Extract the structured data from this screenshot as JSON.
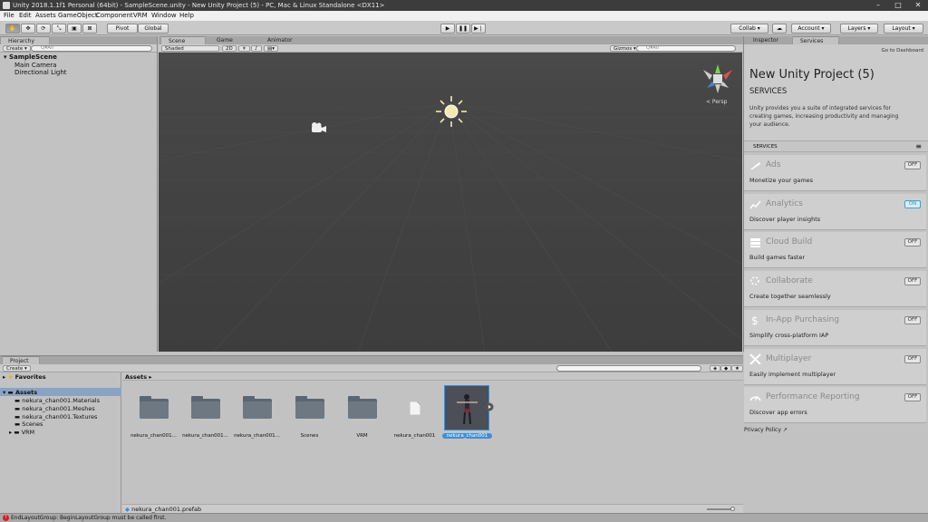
{
  "window": {
    "title": "Unity 2018.1.1f1 Personal (64bit) - SampleScene.unity - New Unity Project (5) - PC, Mac & Linux Standalone <DX11>",
    "minimize": "–",
    "maximize": "□",
    "close": "✕"
  },
  "menu": [
    "File",
    "Edit",
    "Assets",
    "GameObject",
    "Component",
    "VRM",
    "Window",
    "Help"
  ],
  "toolbar": {
    "pivot": "Pivot",
    "global": "Global",
    "collab": "Collab ▾",
    "account": "Account ▾",
    "layers": "Layers ▾",
    "layout": "Layout ▾"
  },
  "hierarchy": {
    "tab": "Hierarchy",
    "create": "Create ▾",
    "search": "Q▾All",
    "scene": "SampleScene",
    "items": [
      "Main Camera",
      "Directional Light"
    ]
  },
  "scene": {
    "tabs": [
      "Scene",
      "Game",
      "Animator"
    ],
    "shading": "Shaded",
    "mode2d": "2D",
    "gizmos": "Gizmos ▾",
    "search": "Q▾All",
    "persp": "< Persp"
  },
  "inspector": {
    "tabs": [
      "Inspector",
      "Services"
    ],
    "dashboard": "Go to Dashboard",
    "project_name": "New Unity Project (5)",
    "heading": "SERVICES",
    "description": "Unity provides you a suite of integrated services for creating games, increasing productivity and managing your audience.",
    "section_label": "SERVICES",
    "privacy": "Privacy Policy"
  },
  "services": [
    {
      "name": "Ads",
      "desc": "Monetize your games",
      "state": "OFF"
    },
    {
      "name": "Analytics",
      "desc": "Discover player insights",
      "state": "ON"
    },
    {
      "name": "Cloud Build",
      "desc": "Build games faster",
      "state": "OFF"
    },
    {
      "name": "Collaborate",
      "desc": "Create together seamlessly",
      "state": "OFF"
    },
    {
      "name": "In-App Purchasing",
      "desc": "Simplify cross-platform IAP",
      "state": "OFF"
    },
    {
      "name": "Multiplayer",
      "desc": "Easily implement multiplayer",
      "state": "OFF"
    },
    {
      "name": "Performance Reporting",
      "desc": "Discover app errors",
      "state": "OFF"
    }
  ],
  "project": {
    "tab": "Project",
    "create": "Create ▾",
    "favorites": "Favorites",
    "assets_root": "Assets",
    "tree": [
      "nekura_chan001.Materials",
      "nekura_chan001.Meshes",
      "nekura_chan001.Textures",
      "Scenes",
      "VRM"
    ],
    "breadcrumb": "Assets ▸",
    "assets": [
      "nekura_chan001...",
      "nekura_chan001...",
      "nekura_chan001...",
      "Scenes",
      "VRM",
      "nekura_chan001",
      "nekura_chan001"
    ],
    "selected_path": "nekura_chan001.prefab"
  },
  "status": {
    "message": "EndLayoutGroup: BeginLayoutGroup must be called first."
  },
  "colors": {
    "accent": "#3d8fd9",
    "scene_bg": "#3f3f3f",
    "panel": "#c2c2c2",
    "error": "#d62020"
  }
}
